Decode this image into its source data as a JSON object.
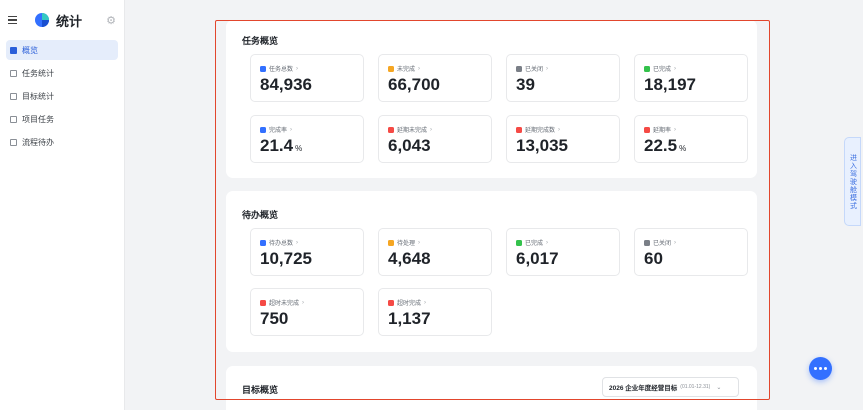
{
  "app": {
    "title": "统计"
  },
  "sidebar": {
    "items": [
      {
        "label": "概览",
        "active": true
      },
      {
        "label": "任务统计"
      },
      {
        "label": "目标统计"
      },
      {
        "label": "项目任务"
      },
      {
        "label": "流程待办"
      }
    ]
  },
  "task_overview": {
    "title": "任务概览",
    "stats": [
      {
        "label": "任务总数",
        "value": "84,936",
        "unit": "",
        "color": "#3370ff"
      },
      {
        "label": "未完成",
        "value": "66,700",
        "unit": "",
        "color": "#f5a623"
      },
      {
        "label": "已关闭",
        "value": "39",
        "unit": "",
        "color": "#7a7f87"
      },
      {
        "label": "已完成",
        "value": "18,197",
        "unit": "",
        "color": "#34c24c"
      },
      {
        "label": "完成率",
        "value": "21.4",
        "unit": "%",
        "color": "#3370ff"
      },
      {
        "label": "延期未完成",
        "value": "6,043",
        "unit": "",
        "color": "#f54a45"
      },
      {
        "label": "延期完成数",
        "value": "13,035",
        "unit": "",
        "color": "#f54a45"
      },
      {
        "label": "延期率",
        "value": "22.5",
        "unit": "%",
        "color": "#f54a45"
      }
    ]
  },
  "todo_overview": {
    "title": "待办概览",
    "stats": [
      {
        "label": "待办总数",
        "value": "10,725",
        "unit": "",
        "color": "#3370ff"
      },
      {
        "label": "待处理",
        "value": "4,648",
        "unit": "",
        "color": "#f5a623"
      },
      {
        "label": "已完成",
        "value": "6,017",
        "unit": "",
        "color": "#34c24c"
      },
      {
        "label": "已关闭",
        "value": "60",
        "unit": "",
        "color": "#7a7f87"
      },
      {
        "label": "超时未完成",
        "value": "750",
        "unit": "",
        "color": "#f54a45"
      },
      {
        "label": "超时完成",
        "value": "1,137",
        "unit": "",
        "color": "#f54a45"
      }
    ]
  },
  "goal_overview": {
    "title": "目标概览",
    "selector": {
      "value": "2026 企业年度经营目标",
      "range": "(01.01-12.31)"
    }
  },
  "side_tab": {
    "label": "进入驾驶舱模式"
  },
  "colors": {
    "accent": "#3370ff",
    "highlight_border": "#e2462d"
  }
}
